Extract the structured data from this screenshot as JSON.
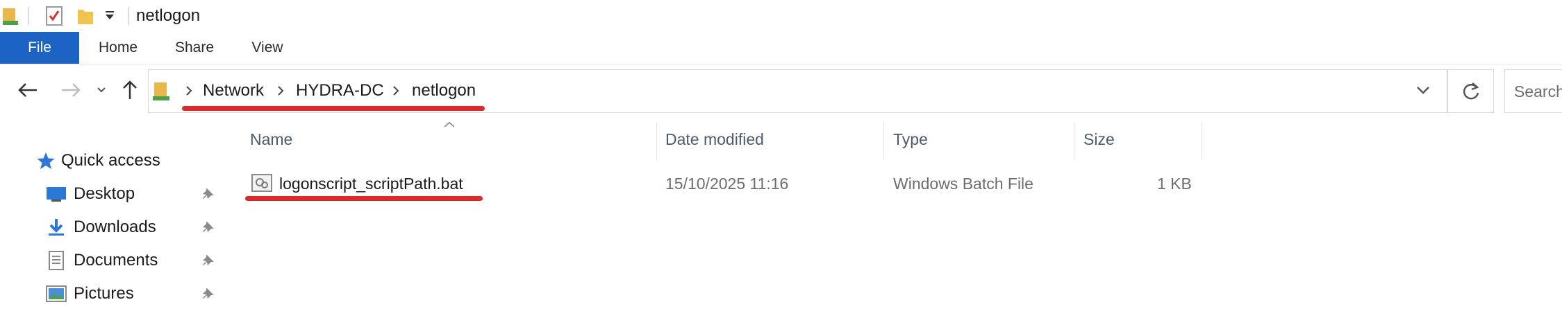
{
  "window": {
    "title": "netlogon"
  },
  "ribbon": {
    "tabs": [
      "File",
      "Home",
      "Share",
      "View"
    ]
  },
  "address_bar": {
    "crumbs": [
      "Network",
      "HYDRA-DC",
      "netlogon"
    ]
  },
  "search": {
    "placeholder": "Search"
  },
  "sidebar": {
    "items": [
      {
        "label": "Quick access",
        "icon": "star-icon"
      },
      {
        "label": "Desktop",
        "icon": "desktop-icon",
        "pinned": true
      },
      {
        "label": "Downloads",
        "icon": "download-icon",
        "pinned": true
      },
      {
        "label": "Documents",
        "icon": "documents-icon",
        "pinned": true
      },
      {
        "label": "Pictures",
        "icon": "pictures-icon",
        "pinned": true
      }
    ]
  },
  "file_list": {
    "columns": [
      "Name",
      "Date modified",
      "Type",
      "Size"
    ],
    "rows": [
      {
        "name": "logonscript_scriptPath.bat",
        "date_modified": "15/10/2025 11:16",
        "type": "Windows Batch File",
        "size": "1 KB"
      }
    ]
  },
  "colors": {
    "file_tab": "#1c63c4",
    "annotation": "#e0282b"
  }
}
